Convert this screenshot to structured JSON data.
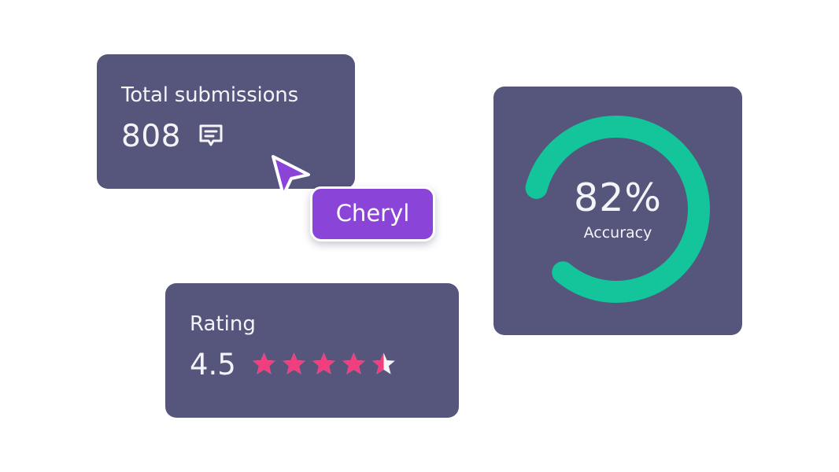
{
  "submissions": {
    "label": "Total submissions",
    "value": "808",
    "icon": "message-icon"
  },
  "cursor_badge": {
    "name": "Cheryl",
    "color": "#8b44d8"
  },
  "rating": {
    "label": "Rating",
    "value": "4.5",
    "stars_max": 5,
    "stars_filled": 4.5,
    "star_color": "#f03e7f"
  },
  "accuracy": {
    "percent_text": "82%",
    "label": "Accuracy",
    "progress": 0.82,
    "ring_color": "#14c49a"
  },
  "colors": {
    "card_bg": "#56557c",
    "text": "#f4f4f8"
  }
}
